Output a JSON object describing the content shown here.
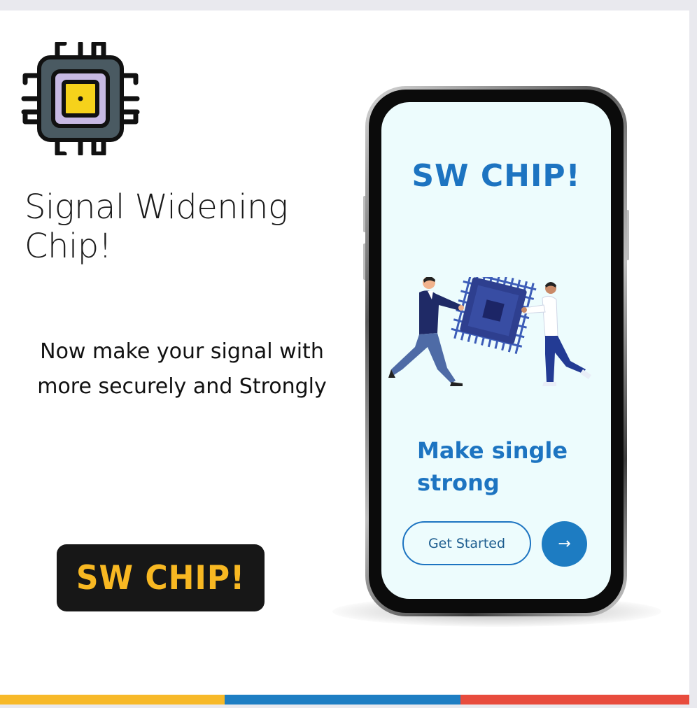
{
  "hero": {
    "headline": "Signal Widening Chip!",
    "subtext": "Now make your signal with more securely and Strongly",
    "badge_label": "SW CHIP!"
  },
  "phone_screen": {
    "title": "SW CHIP!",
    "headline": "Make single strong",
    "get_started_label": "Get Started",
    "next_arrow": "→"
  },
  "icons": {
    "chip": "microchip-icon",
    "next": "arrow-right-icon"
  },
  "colors": {
    "brand_blue": "#1d74c1",
    "brand_yellow": "#f8b822",
    "stripe_yellow": "#f7b929",
    "stripe_blue": "#1e7ec3",
    "stripe_red": "#e84c3d",
    "screen_bg": "#edfcfd"
  }
}
